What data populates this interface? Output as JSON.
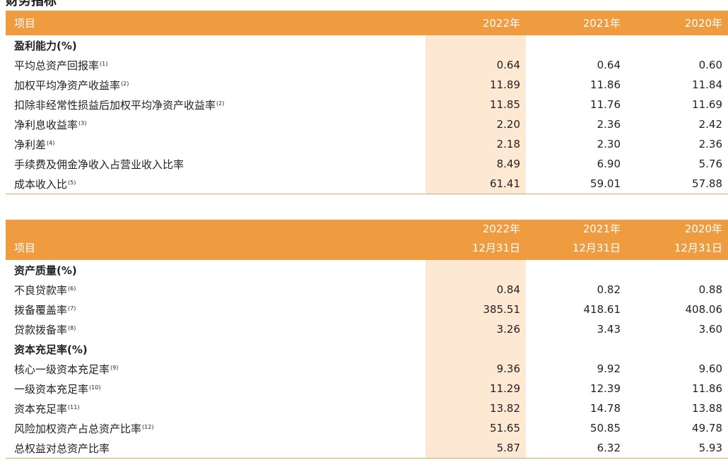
{
  "page_title": "财务指标",
  "table1": {
    "headers": [
      "项目",
      "2022年",
      "2021年",
      "2020年"
    ],
    "rows": [
      {
        "label": "盈利能力(%)",
        "sup": "",
        "section": true,
        "values": [
          "",
          "",
          ""
        ]
      },
      {
        "label": "平均总资产回报率",
        "sup": "(1)",
        "section": false,
        "values": [
          "0.64",
          "0.64",
          "0.60"
        ]
      },
      {
        "label": "加权平均净资产收益率",
        "sup": "(2)",
        "section": false,
        "values": [
          "11.89",
          "11.86",
          "11.84"
        ]
      },
      {
        "label": "扣除非经常性损益后加权平均净资产收益率",
        "sup": "(2)",
        "section": false,
        "values": [
          "11.85",
          "11.76",
          "11.69"
        ]
      },
      {
        "label": "净利息收益率",
        "sup": "(3)",
        "section": false,
        "values": [
          "2.20",
          "2.36",
          "2.42"
        ]
      },
      {
        "label": "净利差",
        "sup": "(4)",
        "section": false,
        "values": [
          "2.18",
          "2.30",
          "2.36"
        ]
      },
      {
        "label": "手续费及佣金净收入占营业收入比率",
        "sup": "",
        "section": false,
        "values": [
          "8.49",
          "6.90",
          "5.76"
        ]
      },
      {
        "label": "成本收入比",
        "sup": "(5)",
        "section": false,
        "values": [
          "61.41",
          "59.01",
          "57.88"
        ]
      }
    ]
  },
  "table2": {
    "headers": {
      "label": "项目",
      "years": [
        "2022年",
        "2021年",
        "2020年"
      ],
      "dates": [
        "12月31日",
        "12月31日",
        "12月31日"
      ]
    },
    "rows": [
      {
        "label": "资产质量(%)",
        "sup": "",
        "section": true,
        "values": [
          "",
          "",
          ""
        ]
      },
      {
        "label": "不良贷款率",
        "sup": "(6)",
        "section": false,
        "values": [
          "0.84",
          "0.82",
          "0.88"
        ]
      },
      {
        "label": "拨备覆盖率",
        "sup": "(7)",
        "section": false,
        "values": [
          "385.51",
          "418.61",
          "408.06"
        ]
      },
      {
        "label": "贷款拨备率",
        "sup": "(8)",
        "section": false,
        "values": [
          "3.26",
          "3.43",
          "3.60"
        ]
      },
      {
        "label": "资本充足率(%)",
        "sup": "",
        "section": true,
        "values": [
          "",
          "",
          ""
        ]
      },
      {
        "label": "核心一级资本充足率",
        "sup": "(9)",
        "section": false,
        "values": [
          "9.36",
          "9.92",
          "9.60"
        ]
      },
      {
        "label": "一级资本充足率",
        "sup": "(10)",
        "section": false,
        "values": [
          "11.29",
          "12.39",
          "11.86"
        ]
      },
      {
        "label": "资本充足率",
        "sup": "(11)",
        "section": false,
        "values": [
          "13.82",
          "14.78",
          "13.88"
        ]
      },
      {
        "label": "风险加权资产占总资产比率",
        "sup": "(12)",
        "section": false,
        "values": [
          "51.65",
          "50.85",
          "49.78"
        ]
      },
      {
        "label": "总权益对总资产比率",
        "sup": "",
        "section": false,
        "values": [
          "5.87",
          "6.32",
          "5.93"
        ]
      }
    ]
  },
  "colors": {
    "header_bg": "#ef9b3f",
    "header_text": "#ffffff",
    "highlight_col": "#fde8d4",
    "rule": "#d8a868"
  }
}
